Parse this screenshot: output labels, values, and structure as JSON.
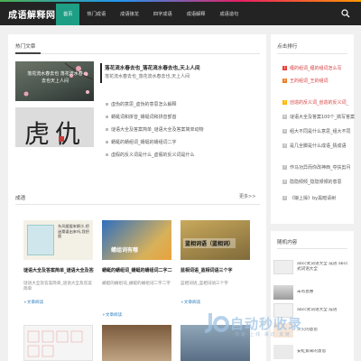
{
  "header": {
    "logo": "成语解释网",
    "nav": [
      "首页",
      "热门成语",
      "成语接龙",
      "四字成语",
      "成语解释",
      "成语造句"
    ]
  },
  "hot_articles": {
    "title": "热门文章",
    "thumb1_text": "落花流水春去也 落花流水春去也天上人间",
    "thumb2_chars": "虎仇",
    "featured": {
      "title": "落花流水春去也_落花流水春去也,天上人间",
      "desc": "落花流水春去也_落花流水春去也,天上人间"
    },
    "list": [
      "虚伪的意思_虚伪的意思怎么解释",
      "蜻蜓词和拼音_蜻蜓词和拼音部首",
      "谜语大全及答案简单_谜语大全及答案简单动物",
      "蜻蜓的蜻组词_蜻蜓的蜻组词二字",
      "虚假的反义词是什么_虚假的反义词是什么"
    ]
  },
  "sidebar_hot": {
    "title": "点击排行",
    "items": [
      "缠的组词_缠的组词怎么写",
      "王的组词_王的组词",
      "创造的反义词_创造的反义词_",
      "谜语大全及答案100个_搞写答案",
      "组大不同是什么意思_组大不同",
      "是几全脚是什么成语_猜成语",
      "作马功异而你改神西_夺扶剪月",
      "隐隐倾倾_隐隐倾倾的意思",
      "《娘上操》by黑暗请树"
    ]
  },
  "idioms": {
    "title": "成语",
    "more": "更多>>",
    "items": [
      {
        "img_text": "东风缓缓来解沙,把迷雾逼出来吗,我把图",
        "title": "谜语大全及答案简单_谜语大全及答案简单",
        "desc": "谜语大全及答案简单_谜语大全及答案简单",
        "more": "+文章阅读"
      },
      {
        "img_text": "蜻组词有哪",
        "title": "蜻蜓的蜻组词_蜻蜓的蜻组词二字二字",
        "desc": "蜻蜓的蜻组词_蜻蜓的蜻组词二字二字",
        "more": "+文章阅读"
      },
      {
        "img_text": "蓝相词语（蓝相词）",
        "title": "蓝相词语_蓝相词语三个字",
        "desc": "蓝相词语_蓝相词语三个字",
        "more": "+文章阅读"
      }
    ]
  },
  "recommend": {
    "title": "随机内容",
    "items": [
      "abcc式词语大全 成语 abcc式词语大全",
      "未有恩惠",
      "abcc式词语大全 成语",
      "火火的意思",
      "安虹紫来的意思"
    ]
  },
  "watermark": {
    "text": "自动秒收录",
    "sub": "· 快 速 · 上 线 · 来 访 · 友 链"
  },
  "colors": {
    "header": "#232323",
    "active_nav": "#1e9e84",
    "accent_red": "#e9413a"
  }
}
